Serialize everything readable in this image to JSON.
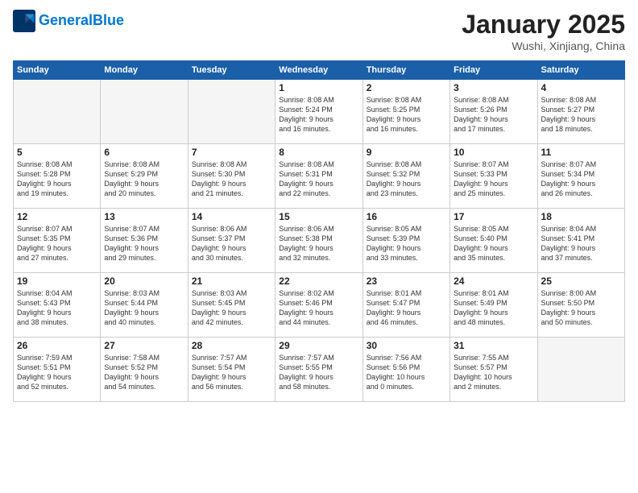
{
  "logo": {
    "line1": "General",
    "line2": "Blue"
  },
  "header": {
    "month": "January 2025",
    "location": "Wushi, Xinjiang, China"
  },
  "weekdays": [
    "Sunday",
    "Monday",
    "Tuesday",
    "Wednesday",
    "Thursday",
    "Friday",
    "Saturday"
  ],
  "weeks": [
    [
      {
        "day": "",
        "info": ""
      },
      {
        "day": "",
        "info": ""
      },
      {
        "day": "",
        "info": ""
      },
      {
        "day": "1",
        "info": "Sunrise: 8:08 AM\nSunset: 5:24 PM\nDaylight: 9 hours\nand 16 minutes."
      },
      {
        "day": "2",
        "info": "Sunrise: 8:08 AM\nSunset: 5:25 PM\nDaylight: 9 hours\nand 16 minutes."
      },
      {
        "day": "3",
        "info": "Sunrise: 8:08 AM\nSunset: 5:26 PM\nDaylight: 9 hours\nand 17 minutes."
      },
      {
        "day": "4",
        "info": "Sunrise: 8:08 AM\nSunset: 5:27 PM\nDaylight: 9 hours\nand 18 minutes."
      }
    ],
    [
      {
        "day": "5",
        "info": "Sunrise: 8:08 AM\nSunset: 5:28 PM\nDaylight: 9 hours\nand 19 minutes."
      },
      {
        "day": "6",
        "info": "Sunrise: 8:08 AM\nSunset: 5:29 PM\nDaylight: 9 hours\nand 20 minutes."
      },
      {
        "day": "7",
        "info": "Sunrise: 8:08 AM\nSunset: 5:30 PM\nDaylight: 9 hours\nand 21 minutes."
      },
      {
        "day": "8",
        "info": "Sunrise: 8:08 AM\nSunset: 5:31 PM\nDaylight: 9 hours\nand 22 minutes."
      },
      {
        "day": "9",
        "info": "Sunrise: 8:08 AM\nSunset: 5:32 PM\nDaylight: 9 hours\nand 23 minutes."
      },
      {
        "day": "10",
        "info": "Sunrise: 8:07 AM\nSunset: 5:33 PM\nDaylight: 9 hours\nand 25 minutes."
      },
      {
        "day": "11",
        "info": "Sunrise: 8:07 AM\nSunset: 5:34 PM\nDaylight: 9 hours\nand 26 minutes."
      }
    ],
    [
      {
        "day": "12",
        "info": "Sunrise: 8:07 AM\nSunset: 5:35 PM\nDaylight: 9 hours\nand 27 minutes."
      },
      {
        "day": "13",
        "info": "Sunrise: 8:07 AM\nSunset: 5:36 PM\nDaylight: 9 hours\nand 29 minutes."
      },
      {
        "day": "14",
        "info": "Sunrise: 8:06 AM\nSunset: 5:37 PM\nDaylight: 9 hours\nand 30 minutes."
      },
      {
        "day": "15",
        "info": "Sunrise: 8:06 AM\nSunset: 5:38 PM\nDaylight: 9 hours\nand 32 minutes."
      },
      {
        "day": "16",
        "info": "Sunrise: 8:05 AM\nSunset: 5:39 PM\nDaylight: 9 hours\nand 33 minutes."
      },
      {
        "day": "17",
        "info": "Sunrise: 8:05 AM\nSunset: 5:40 PM\nDaylight: 9 hours\nand 35 minutes."
      },
      {
        "day": "18",
        "info": "Sunrise: 8:04 AM\nSunset: 5:41 PM\nDaylight: 9 hours\nand 37 minutes."
      }
    ],
    [
      {
        "day": "19",
        "info": "Sunrise: 8:04 AM\nSunset: 5:43 PM\nDaylight: 9 hours\nand 38 minutes."
      },
      {
        "day": "20",
        "info": "Sunrise: 8:03 AM\nSunset: 5:44 PM\nDaylight: 9 hours\nand 40 minutes."
      },
      {
        "day": "21",
        "info": "Sunrise: 8:03 AM\nSunset: 5:45 PM\nDaylight: 9 hours\nand 42 minutes."
      },
      {
        "day": "22",
        "info": "Sunrise: 8:02 AM\nSunset: 5:46 PM\nDaylight: 9 hours\nand 44 minutes."
      },
      {
        "day": "23",
        "info": "Sunrise: 8:01 AM\nSunset: 5:47 PM\nDaylight: 9 hours\nand 46 minutes."
      },
      {
        "day": "24",
        "info": "Sunrise: 8:01 AM\nSunset: 5:49 PM\nDaylight: 9 hours\nand 48 minutes."
      },
      {
        "day": "25",
        "info": "Sunrise: 8:00 AM\nSunset: 5:50 PM\nDaylight: 9 hours\nand 50 minutes."
      }
    ],
    [
      {
        "day": "26",
        "info": "Sunrise: 7:59 AM\nSunset: 5:51 PM\nDaylight: 9 hours\nand 52 minutes."
      },
      {
        "day": "27",
        "info": "Sunrise: 7:58 AM\nSunset: 5:52 PM\nDaylight: 9 hours\nand 54 minutes."
      },
      {
        "day": "28",
        "info": "Sunrise: 7:57 AM\nSunset: 5:54 PM\nDaylight: 9 hours\nand 56 minutes."
      },
      {
        "day": "29",
        "info": "Sunrise: 7:57 AM\nSunset: 5:55 PM\nDaylight: 9 hours\nand 58 minutes."
      },
      {
        "day": "30",
        "info": "Sunrise: 7:56 AM\nSunset: 5:56 PM\nDaylight: 10 hours\nand 0 minutes."
      },
      {
        "day": "31",
        "info": "Sunrise: 7:55 AM\nSunset: 5:57 PM\nDaylight: 10 hours\nand 2 minutes."
      },
      {
        "day": "",
        "info": ""
      }
    ]
  ]
}
